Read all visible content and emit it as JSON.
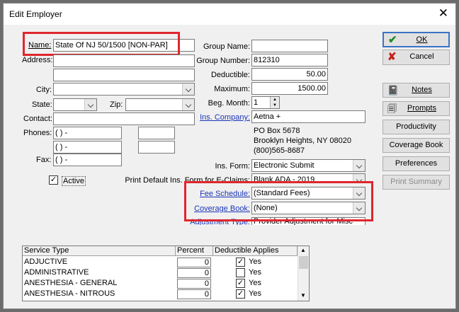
{
  "window": {
    "title": "Edit Employer"
  },
  "form": {
    "name_label": "Name:",
    "name_value": "State Of NJ 50/1500 [NON-PAR]",
    "address_label": "Address:",
    "address1": "",
    "address2": "",
    "city_label": "City:",
    "city_value": "",
    "state_label": "State:",
    "state_value": "",
    "zip_label": "Zip:",
    "zip_value": "",
    "contact_label": "Contact:",
    "contact_value": "",
    "phones_label": "Phones:",
    "phone1": "(   )   -",
    "phone2": "(   )   -",
    "fax_label": "Fax:",
    "fax_value": "(   )   -",
    "active_label": "Active",
    "active_checked": "✓",
    "group_name_label": "Group Name:",
    "group_name_value": "",
    "group_number_label": "Group Number:",
    "group_number_value": "812310",
    "deductible_label": "Deductible:",
    "deductible_value": "50.00",
    "maximum_label": "Maximum:",
    "maximum_value": "1500.00",
    "beg_month_label": "Beg. Month:",
    "beg_month_value": "1",
    "ins_company_label": "Ins. Company:",
    "ins_company_value": "Aetna +",
    "company_address1": "PO Box 5678",
    "company_address2": "Brooklyn Heights, NY 08020",
    "company_phone": "(800)565-8687",
    "ins_form_label": "Ins. Form:",
    "ins_form_value": "Electronic Submit",
    "print_default_label": "Print Default Ins. Form for E-Claims:",
    "print_default_value": "Blank ADA - 2019",
    "fee_schedule_label": "Fee Schedule:",
    "fee_schedule_value": "(Standard Fees)",
    "coverage_book_label": "Coverage Book:",
    "coverage_book_value": "(None)",
    "adjustment_type_label": "Adjustment Type:",
    "adjustment_type_value": "Provider Adjustment for Misc"
  },
  "buttons": {
    "ok": "OK",
    "cancel": "Cancel",
    "notes": "Notes",
    "prompts": "Prompts",
    "productivity": "Productivity",
    "coverage_book": "Coverage Book",
    "preferences": "Preferences",
    "print_summary": "Print Summary"
  },
  "service_table": {
    "headers": [
      "Service Type",
      "Percent",
      "Deductible Applies"
    ],
    "rows": [
      {
        "type": "ADJUCTIVE",
        "percent": "0",
        "checked": "✓",
        "applies": "Yes"
      },
      {
        "type": "ADMINISTRATIVE",
        "percent": "0",
        "checked": "",
        "applies": "Yes"
      },
      {
        "type": "ANESTHESIA - GENERAL",
        "percent": "0",
        "checked": "✓",
        "applies": "Yes"
      },
      {
        "type": "ANESTHESIA - NITROUS",
        "percent": "0",
        "checked": "✓",
        "applies": "Yes"
      }
    ]
  },
  "colors": {
    "highlight": "#e0262d",
    "link": "#1a35b8",
    "ok_check": "#1f8a2a",
    "cancel_x": "#c8201a"
  }
}
